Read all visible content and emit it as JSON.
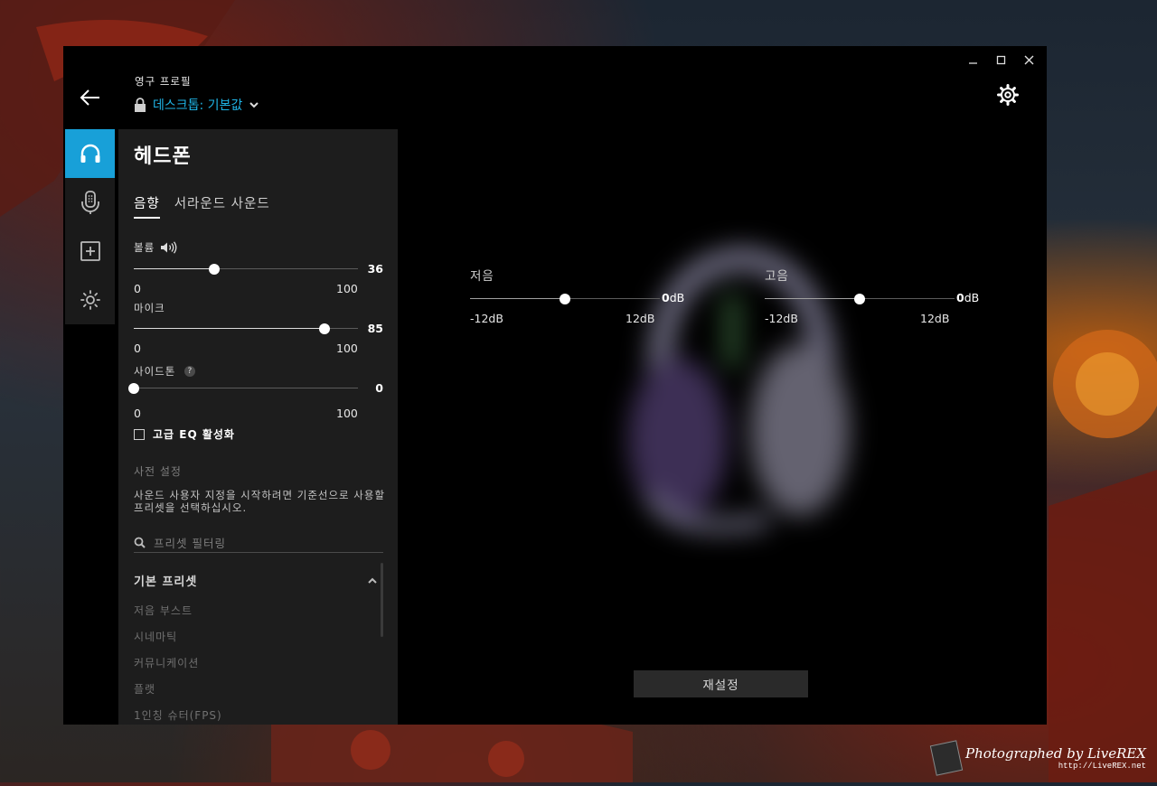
{
  "header": {
    "profile_label": "영구 프로필",
    "profile_name": "데스크톱: 기본값"
  },
  "panel": {
    "title": "헤드폰",
    "tabs": [
      {
        "label": "음향",
        "active": true
      },
      {
        "label": "서라운드 사운드",
        "active": false
      }
    ],
    "volume": {
      "label": "볼륨",
      "value": "36",
      "level": 36,
      "min": "0",
      "max": "100"
    },
    "mic": {
      "label": "마이크",
      "value": "85",
      "level": 85,
      "min": "0",
      "max": "100"
    },
    "sidetone": {
      "label": "사이드톤",
      "value": "0",
      "level": 0,
      "min": "0",
      "max": "100",
      "help": "?"
    },
    "advanced_eq": {
      "label": "고급 EQ 활성화",
      "checked": false
    },
    "presets": {
      "header": "사전 설정",
      "description": "사운드 사용자 지정을 시작하려면 기준선으로 사용할 프리셋을 선택하십시오.",
      "search_placeholder": "프리셋 필터링",
      "group_title": "기본 프리셋",
      "items": [
        "저음 부스트",
        "시네마틱",
        "커뮤니케이션",
        "플랫",
        "1인칭 슈터(FPS)"
      ]
    }
  },
  "eq": {
    "bass": {
      "label": "저음",
      "value": "0",
      "unit": "dB",
      "min": "-12dB",
      "max": "12dB",
      "level": 0
    },
    "treble": {
      "label": "고음",
      "value": "0",
      "unit": "dB",
      "min": "-12dB",
      "max": "12dB",
      "level": 0
    }
  },
  "reset_label": "재설정",
  "watermark": {
    "line1": "Photographed by LiveREX",
    "line2": "http://LiveREX.net"
  },
  "colors": {
    "accent": "#18a0d8",
    "profile_link": "#1fb4e6"
  }
}
